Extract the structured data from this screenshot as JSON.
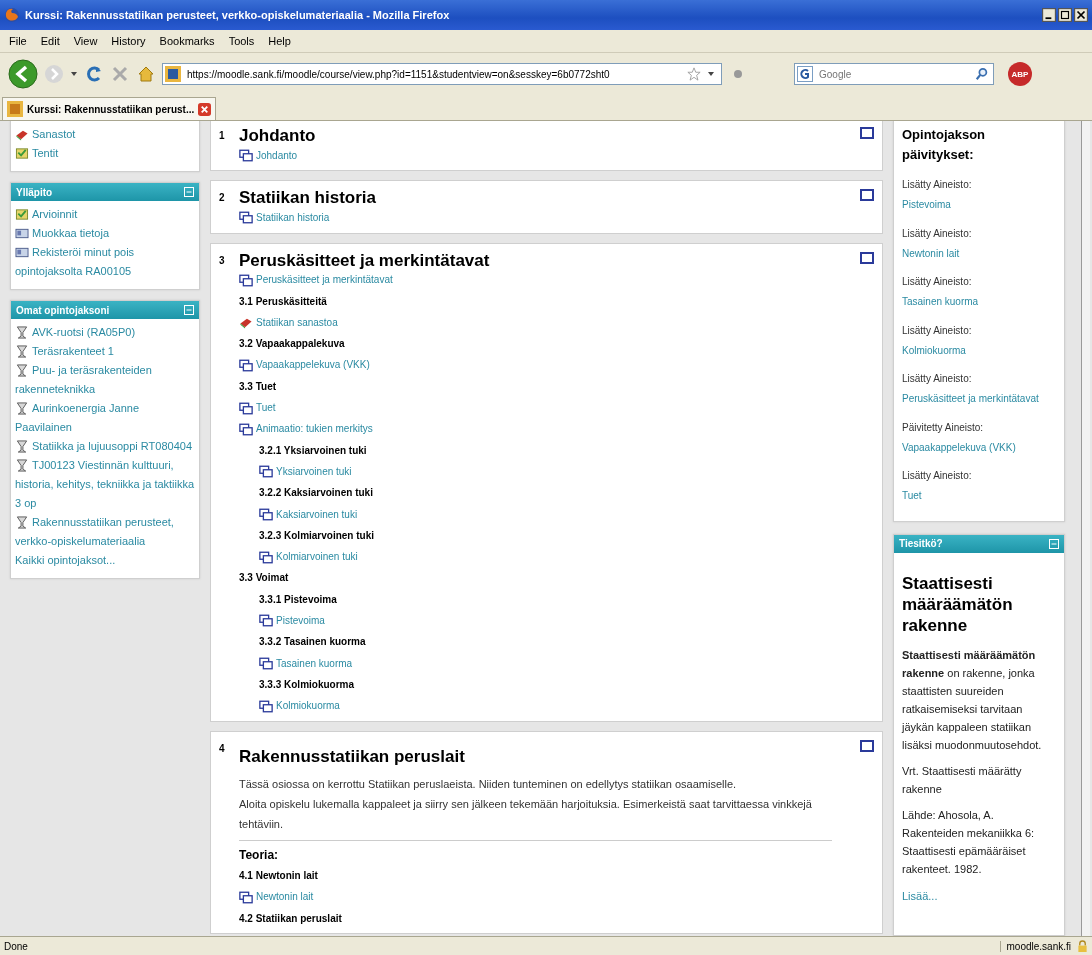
{
  "window": {
    "title": "Kurssi: Rakennusstatiikan perusteet, verkko-opiskelumateriaalia - Mozilla Firefox"
  },
  "menu": [
    "File",
    "Edit",
    "View",
    "History",
    "Bookmarks",
    "Tools",
    "Help"
  ],
  "url": "https://moodle.sank.fi/moodle/course/view.php?id=1151&studentview=on&sesskey=6b0772sht0",
  "search": {
    "placeholder": "Google"
  },
  "adblock": "ABP",
  "tabs": [
    {
      "label": "Kurssi: Rakennusstatiikan perust...",
      "selected": true
    }
  ],
  "left_blocks": [
    {
      "items": [
        {
          "kind": "glossary",
          "text": "Sanastot"
        },
        {
          "kind": "quiz",
          "text": "Tentit"
        }
      ]
    },
    {
      "title": "Ylläpito",
      "items": [
        {
          "kind": "quiz",
          "text": "Arvioinnit"
        },
        {
          "kind": "edit",
          "text": "Muokkaa tietoja"
        },
        {
          "kind": "edit",
          "text": "Rekisteröi minut pois opintojaksolta RA00105"
        }
      ]
    },
    {
      "title": "Omat opintojaksoni",
      "items": [
        {
          "kind": "course",
          "text": "AVK-ruotsi (RA05P0)"
        },
        {
          "kind": "course",
          "text": "Teräsrakenteet 1"
        },
        {
          "kind": "course",
          "text": "Puu- ja teräsrakenteiden rakenneteknikka"
        },
        {
          "kind": "course",
          "text": "Aurinkoenergia Janne Paavilainen"
        },
        {
          "kind": "course",
          "text": "Statiikka ja lujuusoppi RT080404"
        },
        {
          "kind": "course",
          "text": "TJ00123 Viestinnän kulttuuri, historia, kehitys, tekniikka ja taktiikka 3 op"
        },
        {
          "kind": "course",
          "text": "Rakennusstatiikan perusteet, verkko-opiskelumateriaalia"
        },
        {
          "kind": "link",
          "text": "Kaikki opintojaksot..."
        }
      ]
    }
  ],
  "sections": [
    {
      "number": "1",
      "title": "Johdanto",
      "items": [
        {
          "kind": "resource",
          "text": "Johdanto"
        }
      ]
    },
    {
      "number": "2",
      "title": "Statiikan historia",
      "items": [
        {
          "kind": "resource",
          "text": "Statiikan historia"
        }
      ]
    },
    {
      "number": "3",
      "title": "Peruskäsitteet ja merkintätavat",
      "items": [
        {
          "kind": "resource",
          "text": "Peruskäsitteet ja merkintätavat"
        },
        {
          "kind": "heading",
          "text": "3.1 Peruskäsitteitä"
        },
        {
          "kind": "glossary",
          "text": "Statiikan sanastoa"
        },
        {
          "kind": "heading",
          "text": "3.2 Vapaakappalekuva"
        },
        {
          "kind": "resource",
          "text": "Vapaakappelekuva (VKK)"
        },
        {
          "kind": "heading",
          "text": "3.3 Tuet"
        },
        {
          "kind": "resource",
          "text": "Tuet"
        },
        {
          "kind": "resource",
          "text": "Animaatio: tukien merkitys",
          "children": [
            {
              "kind": "heading",
              "text": "3.2.1 Yksiarvoinen tuki"
            },
            {
              "kind": "resource",
              "text": "Yksiarvoinen tuki"
            },
            {
              "kind": "heading",
              "text": "3.2.2 Kaksiarvoinen tuki"
            },
            {
              "kind": "resource",
              "text": "Kaksiarvoinen tuki"
            },
            {
              "kind": "heading",
              "text": "3.2.3 Kolmiarvoinen tuki"
            },
            {
              "kind": "resource",
              "text": "Kolmiarvoinen tuki"
            }
          ]
        },
        {
          "kind": "heading",
          "text": "3.3 Voimat",
          "children": [
            {
              "kind": "heading",
              "text": "3.3.1 Pistevoima"
            },
            {
              "kind": "resource",
              "text": "Pistevoima"
            },
            {
              "kind": "heading",
              "text": "3.3.2 Tasainen kuorma"
            },
            {
              "kind": "resource",
              "text": "Tasainen kuorma"
            },
            {
              "kind": "heading",
              "text": "3.3.3 Kolmiokuorma"
            },
            {
              "kind": "resource",
              "text": "Kolmiokuorma"
            }
          ]
        }
      ]
    },
    {
      "number": "4",
      "title": "Rakennusstatiikan peruslait",
      "summary": [
        "Tässä osiossa on kerrottu Statiikan peruslaeista. Niiden tunteminen on edellytys statiikan osaamiselle.",
        "Aloita opiskelu lukemalla kappaleet ja siirry sen jälkeen tekemään harjoituksia. Esimerkeistä saat tarvittaessa vinkkejä tehtäviin."
      ],
      "subtitle": "Teoria:",
      "items": [
        {
          "kind": "heading",
          "text": "4.1 Newtonin lait"
        },
        {
          "kind": "resource",
          "text": "Newtonin lait"
        },
        {
          "kind": "heading",
          "text": "4.2 Statiikan peruslait"
        }
      ]
    }
  ],
  "updates": {
    "title": "Opintojakson päivitykset:",
    "items": [
      {
        "label": "Lisätty Aineisto:",
        "link": "Pistevoima"
      },
      {
        "label": "Lisätty Aineisto:",
        "link": "Newtonin lait"
      },
      {
        "label": "Lisätty Aineisto:",
        "link": "Tasainen kuorma"
      },
      {
        "label": "Lisätty Aineisto:",
        "link": "Kolmiokuorma"
      },
      {
        "label": "Lisätty Aineisto:",
        "link": "Peruskäsitteet ja merkintätavat"
      },
      {
        "label": "Päivitetty Aineisto:",
        "link": "Vapaakappelekuva (VKK)"
      },
      {
        "label": "Lisätty Aineisto:",
        "link": "Tuet"
      }
    ]
  },
  "didyouknow": {
    "title": "Tiesitkö?",
    "heading": "Staattisesti määräämätön rakenne",
    "paragraphs": [
      "**Staattisesti määräämätön rakenne** on rakenne, jonka staattisten suureiden ratkaisemiseksi tarvitaan jäykän kappaleen statiikan lisäksi muodonmuutosehdot.",
      "Vrt. Staattisesti määrätty rakenne",
      "Lähde: Ahosola, A. Rakenteiden mekaniikka 6: Staattisesti epämääräiset rakenteet. 1982."
    ],
    "more": "Lisää..."
  },
  "status_bar": {
    "text": "Done",
    "host": "moodle.sank.fi"
  }
}
